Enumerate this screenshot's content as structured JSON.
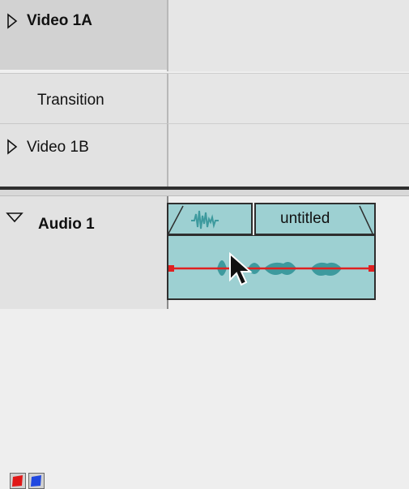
{
  "tracks": {
    "video1a": {
      "label": "Video 1A"
    },
    "transition": {
      "label": "Transition"
    },
    "video1b": {
      "label": "Video 1B"
    },
    "audio1": {
      "label": "Audio 1"
    }
  },
  "audio_clip": {
    "name": "untitled"
  },
  "colors": {
    "clip_fill": "#9dd0d2",
    "waveform": "#3d9a9e",
    "volume_line": "#e02020",
    "handle": "#e02020",
    "button_red": "#e01818",
    "button_blue": "#2048e0"
  },
  "icons": {
    "video1a_toggle": "triangle-right-icon",
    "video1b_toggle": "triangle-right-icon",
    "audio1_toggle": "triangle-down-icon",
    "waveform_thumb": "waveform-icon",
    "cursor": "arrow-cursor-icon"
  }
}
